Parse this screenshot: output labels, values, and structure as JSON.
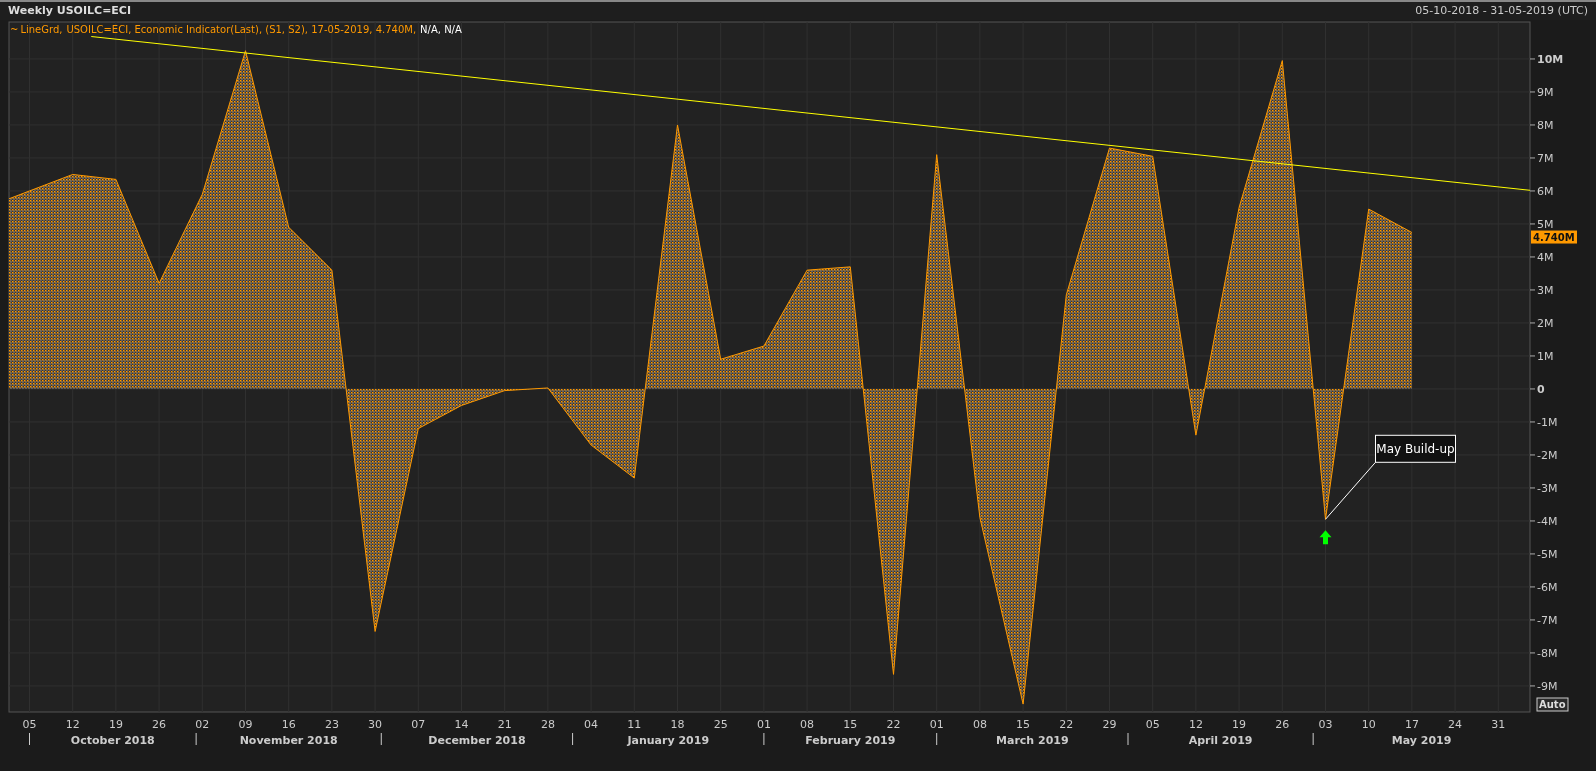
{
  "window": {
    "title": "Weekly USOILC=ECI",
    "date_range": "05-10-2018 - 31-05-2019 (UTC)"
  },
  "legend": {
    "marker": "~",
    "prefix": "LineGrd,",
    "suffix": ", Economic Indicator(Last), (S1, S2), 17-05-2019, 4.740M,",
    "extra": "N/A, N/A"
  },
  "current_value": "4.740M",
  "auto_button": "Auto",
  "months": [
    "October 2018",
    "November 2018",
    "December 2018",
    "January 2019",
    "February 2019",
    "March 2019",
    "April 2019",
    "May 2019"
  ],
  "chart_data": {
    "type": "area",
    "categories": [
      "05",
      "12",
      "19",
      "26",
      "02",
      "09",
      "16",
      "23",
      "30",
      "07",
      "14",
      "21",
      "28",
      "04",
      "11",
      "18",
      "25",
      "01",
      "08",
      "15",
      "22",
      "01",
      "08",
      "15",
      "22",
      "29",
      "05",
      "12",
      "19",
      "26",
      "03",
      "10",
      "17",
      "24",
      "31"
    ],
    "series": [
      {
        "name": "USOILC=ECI",
        "color": "#ff9900",
        "values": [
          6.0,
          6.5,
          6.35,
          3.2,
          5.9,
          10.25,
          4.9,
          3.6,
          -7.35,
          -1.2,
          -0.5,
          -0.05,
          0.03,
          -1.7,
          -2.7,
          8.0,
          0.9,
          1.3,
          3.6,
          3.7,
          -8.65,
          7.1,
          -3.9,
          -9.55,
          2.85,
          7.3,
          7.05,
          -1.4,
          5.5,
          9.95,
          -3.95,
          5.45,
          4.74,
          null,
          null
        ]
      }
    ],
    "ylim": [
      -9.79,
      11.12
    ],
    "grid": true,
    "yticks": [
      {
        "value": 10,
        "label": "10M"
      },
      {
        "value": 9,
        "label": "9M"
      },
      {
        "value": 8,
        "label": "8M"
      },
      {
        "value": 7,
        "label": "7M"
      },
      {
        "value": 6,
        "label": "6M"
      },
      {
        "value": 5,
        "label": "5M"
      },
      {
        "value": 4,
        "label": "4M"
      },
      {
        "value": 3,
        "label": "3M"
      },
      {
        "value": 2,
        "label": "2M"
      },
      {
        "value": 1,
        "label": "1M"
      },
      {
        "value": 0,
        "label": "0"
      },
      {
        "value": -1,
        "label": "-1M"
      },
      {
        "value": -2,
        "label": "-2M"
      },
      {
        "value": -3,
        "label": "-3M"
      },
      {
        "value": -4,
        "label": "-4M"
      },
      {
        "value": -5,
        "label": "-5M"
      },
      {
        "value": -6,
        "label": "-6M"
      },
      {
        "value": -7,
        "label": "-7M"
      },
      {
        "value": -8,
        "label": "-8M"
      },
      {
        "value": -9,
        "label": "-9M"
      }
    ],
    "annotations": [
      {
        "text": "May Build-up",
        "x": "03",
        "y": -3.95
      }
    ]
  }
}
